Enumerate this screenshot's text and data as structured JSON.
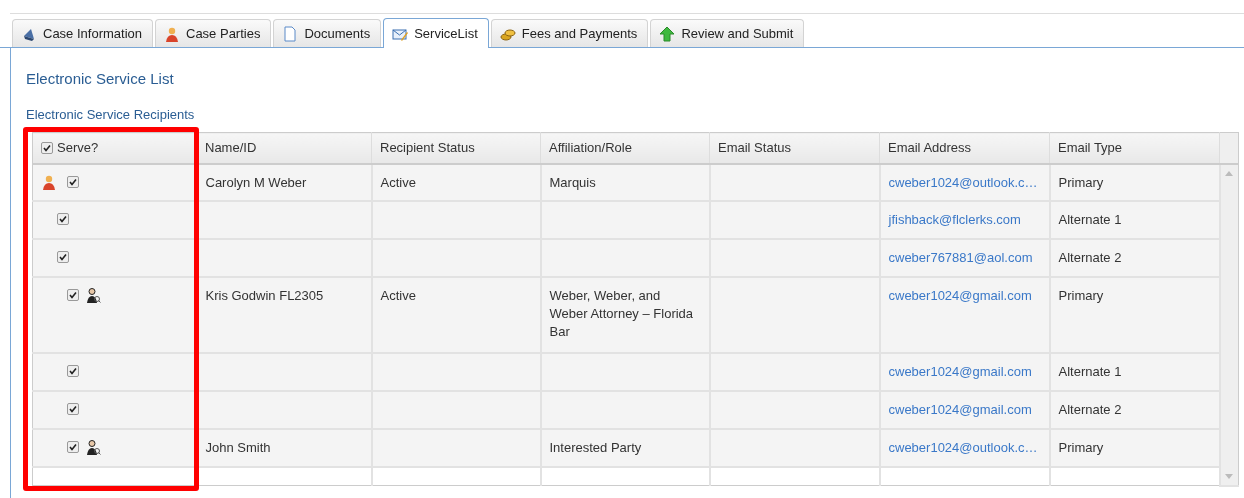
{
  "tabs": [
    {
      "label": "Case Information",
      "selected": false
    },
    {
      "label": "Case Parties",
      "selected": false
    },
    {
      "label": "Documents",
      "selected": false
    },
    {
      "label": "ServiceList",
      "selected": true
    },
    {
      "label": "Fees and Payments",
      "selected": false
    },
    {
      "label": "Review and Submit",
      "selected": false
    }
  ],
  "heading": "Electronic Service List",
  "subheading": "Electronic Service Recipients",
  "table": {
    "columns": [
      {
        "label": "Serve?",
        "kind": "checkbox",
        "checked": true,
        "highlighted": true
      },
      {
        "label": "Name/ID",
        "highlighted": false
      },
      {
        "label": "Recipient Status",
        "highlighted": false
      },
      {
        "label": "Affiliation/Role",
        "highlighted": false
      },
      {
        "label": "Email Status",
        "highlighted": false
      },
      {
        "label": "Email Address",
        "highlighted": false
      },
      {
        "label": "Email Type",
        "highlighted": false
      }
    ],
    "rows": [
      {
        "kind": "party",
        "serve": true,
        "name": "Carolyn M Weber",
        "status": "Active",
        "affiliation": "Marquis",
        "email": "cweber1024@outlook.c…",
        "email_type": "Primary"
      },
      {
        "kind": "party-email",
        "serve": true,
        "email": "jfishback@flclerks.com",
        "email_type": "Alternate 1"
      },
      {
        "kind": "party-email",
        "serve": true,
        "email": "cweber767881@aol.com",
        "email_type": "Alternate 2"
      },
      {
        "kind": "attorney",
        "serve": true,
        "name": "Kris Godwin FL2305",
        "status": "Active",
        "affiliation": "Weber, Weber, and Weber Attorney – Florida Bar",
        "email": "cweber1024@gmail.com",
        "email_type": "Primary"
      },
      {
        "kind": "attorney-email",
        "serve": true,
        "email": "cweber1024@gmail.com",
        "email_type": "Alternate 1"
      },
      {
        "kind": "attorney-email",
        "serve": true,
        "email": "cweber1024@gmail.com",
        "email_type": "Alternate 2"
      },
      {
        "kind": "attorney",
        "serve": true,
        "name": "John Smith",
        "affiliation": "Interested Party",
        "email": "cweber1024@outlook.c…",
        "email_type": "Primary"
      }
    ]
  }
}
